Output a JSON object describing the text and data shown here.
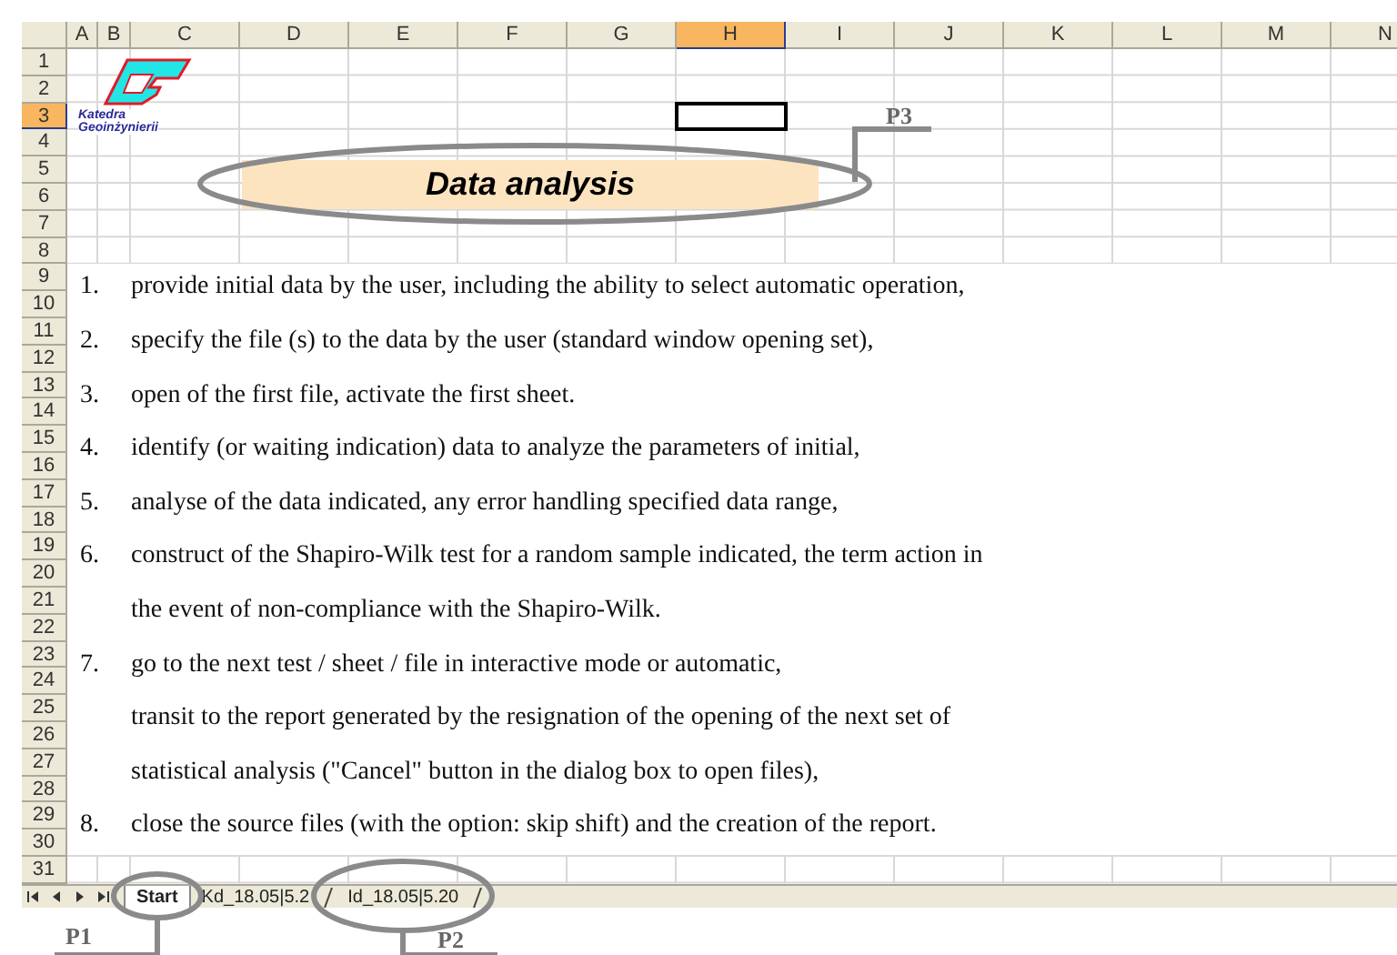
{
  "logo": {
    "lines": [
      "Katedra",
      "Geoinżynierii"
    ]
  },
  "columns": [
    {
      "label": "A",
      "selected": false
    },
    {
      "label": "B",
      "selected": false
    },
    {
      "label": "C",
      "selected": false
    },
    {
      "label": "D",
      "selected": false
    },
    {
      "label": "E",
      "selected": false
    },
    {
      "label": "F",
      "selected": false
    },
    {
      "label": "G",
      "selected": false
    },
    {
      "label": "H",
      "selected": true
    },
    {
      "label": "I",
      "selected": false
    },
    {
      "label": "J",
      "selected": false
    },
    {
      "label": "K",
      "selected": false
    },
    {
      "label": "L",
      "selected": false
    },
    {
      "label": "M",
      "selected": false
    },
    {
      "label": "N",
      "selected": false
    }
  ],
  "rows": [
    {
      "label": "1",
      "selected": false
    },
    {
      "label": "2",
      "selected": false
    },
    {
      "label": "3",
      "selected": true
    },
    {
      "label": "4",
      "selected": false
    },
    {
      "label": "5",
      "selected": false
    },
    {
      "label": "6",
      "selected": false
    },
    {
      "label": "7",
      "selected": false
    },
    {
      "label": "8",
      "selected": false
    },
    {
      "label": "9",
      "selected": false
    },
    {
      "label": "10",
      "selected": false
    },
    {
      "label": "11",
      "selected": false
    },
    {
      "label": "12",
      "selected": false
    },
    {
      "label": "13",
      "selected": false
    },
    {
      "label": "14",
      "selected": false
    },
    {
      "label": "15",
      "selected": false
    },
    {
      "label": "16",
      "selected": false
    },
    {
      "label": "17",
      "selected": false
    },
    {
      "label": "18",
      "selected": false
    },
    {
      "label": "19",
      "selected": false
    },
    {
      "label": "20",
      "selected": false
    },
    {
      "label": "21",
      "selected": false
    },
    {
      "label": "22",
      "selected": false
    },
    {
      "label": "23",
      "selected": false
    },
    {
      "label": "24",
      "selected": false
    },
    {
      "label": "25",
      "selected": false
    },
    {
      "label": "26",
      "selected": false
    },
    {
      "label": "27",
      "selected": false
    },
    {
      "label": "28",
      "selected": false
    },
    {
      "label": "29",
      "selected": false
    },
    {
      "label": "30",
      "selected": false
    },
    {
      "label": "31",
      "selected": false
    }
  ],
  "title": "Data analysis",
  "steps": [
    {
      "number": "1.",
      "lines": [
        "provide initial data by the user, including the ability to select automatic operation,"
      ]
    },
    {
      "number": "2.",
      "lines": [
        "specify the file (s) to the data by the user (standard window opening set),"
      ]
    },
    {
      "number": "3.",
      "lines": [
        "open of the first file, activate the first sheet."
      ]
    },
    {
      "number": "4.",
      "lines": [
        "identify (or waiting indication) data to analyze the parameters of initial,"
      ]
    },
    {
      "number": "5.",
      "lines": [
        "analyse of the data indicated, any error handling specified data range,"
      ]
    },
    {
      "number": "6.",
      "lines": [
        "construct of the Shapiro-Wilk test for a random sample indicated, the term action in",
        "the event of non-compliance with the Shapiro-Wilk."
      ]
    },
    {
      "number": "7.",
      "lines": [
        "go to the next test / sheet / file in interactive mode or automatic,",
        "transit to the report generated by the resignation of the opening of the next set of",
        "statistical analysis (\"Cancel\" button in the dialog box to open files),"
      ]
    },
    {
      "number": "8.",
      "lines": [
        "close the source files (with the option: skip shift) and the creation of the report."
      ]
    }
  ],
  "sheet_tabs": [
    {
      "label": "Start",
      "selected": true
    },
    {
      "label": "Kd_18.05|5.2",
      "selected": false
    },
    {
      "label": "Id_18.05|5.20",
      "selected": false
    }
  ],
  "callouts": [
    {
      "label": "P3"
    },
    {
      "label": "P1"
    },
    {
      "label": "P2"
    }
  ]
}
